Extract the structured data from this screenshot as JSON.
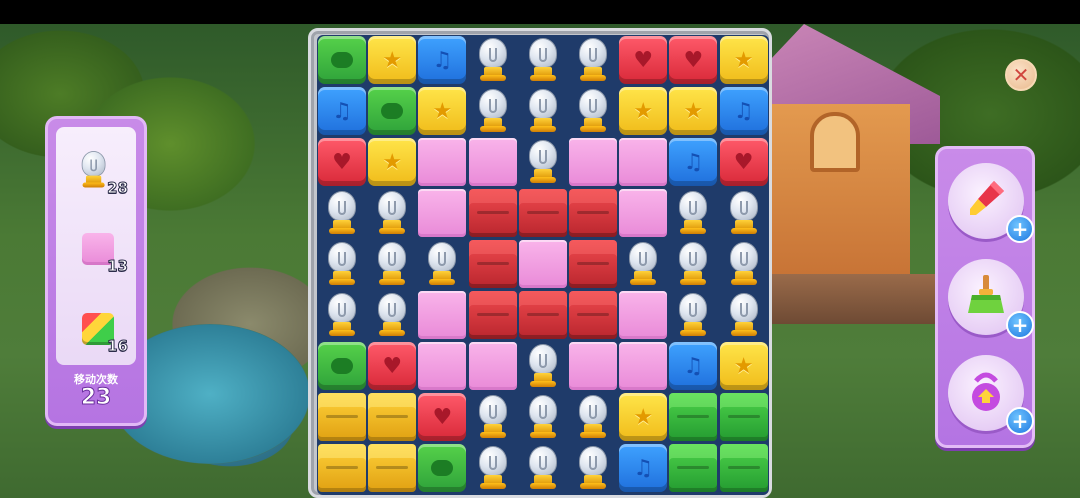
{
  "goals": [
    {
      "name": "light-bulb",
      "count": "28"
    },
    {
      "name": "pink-cushion",
      "count": "13"
    },
    {
      "name": "green-stripe-block",
      "count": "16"
    }
  ],
  "moves": {
    "label": "移动次数",
    "count": "23"
  },
  "boosters": [
    {
      "name": "rocket-booster",
      "icon": "rocket-icon"
    },
    {
      "name": "broom-booster",
      "icon": "broom-icon"
    },
    {
      "name": "kettlebell-booster",
      "icon": "kettlebell-icon"
    }
  ],
  "close_icon": "close-icon",
  "board": {
    "rows": [
      [
        "green",
        "yellow",
        "blue",
        "bulb",
        "bulb",
        "bulb",
        "red",
        "red",
        "yellow"
      ],
      [
        "blue",
        "green",
        "yellow",
        "bulb",
        "bulb",
        "bulb",
        "yellow",
        "yellow",
        "blue"
      ],
      [
        "red",
        "yellow",
        "pink",
        "pink",
        "bulb",
        "pink",
        "pink",
        "blue",
        "red"
      ],
      [
        "bulb",
        "bulb",
        "pink",
        "crate",
        "crate",
        "crate",
        "pink",
        "bulb",
        "bulb"
      ],
      [
        "bulb",
        "bulb",
        "bulb",
        "crate",
        "pink",
        "crate",
        "bulb",
        "bulb",
        "bulb"
      ],
      [
        "bulb",
        "bulb",
        "pink",
        "crate",
        "crate",
        "crate",
        "pink",
        "bulb",
        "bulb"
      ],
      [
        "green",
        "red",
        "pink",
        "pink",
        "bulb",
        "pink",
        "pink",
        "blue",
        "yellow"
      ],
      [
        "crate-yellow",
        "crate-yellow",
        "red",
        "bulb",
        "bulb",
        "bulb",
        "yellow",
        "crate-green",
        "crate-green"
      ],
      [
        "crate-yellow",
        "crate-yellow",
        "green",
        "bulb",
        "bulb",
        "bulb",
        "blue",
        "crate-green",
        "crate-green"
      ]
    ]
  },
  "colors": {
    "panel_purple": "#b574e2",
    "board_frame": "#c3c6cc",
    "plus_blue": "#1f78e0"
  }
}
